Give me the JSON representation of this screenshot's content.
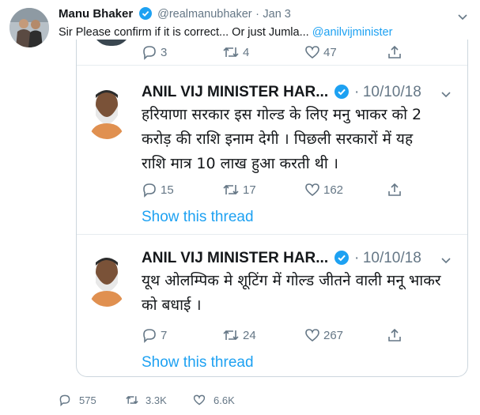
{
  "tweet": {
    "author_name": "Manu Bhaker",
    "handle": "@realmanubhaker",
    "separator": "·",
    "date": "Jan 3",
    "text": "Sir Please confirm if it is correct... Or just Jumla... ",
    "mention": "@anilvijminister"
  },
  "embed_top_stats": {
    "replies": "3",
    "retweets": "4",
    "likes": "47"
  },
  "quoted": [
    {
      "author_name": "ANIL VIJ MINISTER HAR...",
      "separator": "·",
      "date": "10/10/18",
      "lines": [
        "हरियाणा सरकार इस गोल्ड के लिए मनु भाकर को 2",
        "करोड़ की राशि इनाम देगी । पिछली सरकारों में यह",
        "राशि मात्र 10 लाख हुआ करती थी ।"
      ],
      "replies": "15",
      "retweets": "17",
      "likes": "162",
      "show_thread": "Show this thread"
    },
    {
      "author_name": "ANIL VIJ MINISTER HAR...",
      "separator": "·",
      "date": "10/10/18",
      "lines": [
        "यूथ ओलम्पिक मे शूटिंग में गोल्ड जीतने वाली मनू भाकर",
        "को बधाई ।"
      ],
      "replies": "7",
      "retweets": "24",
      "likes": "267",
      "show_thread": "Show this thread"
    }
  ],
  "tweet_stats": {
    "replies": "575",
    "retweets": "3.3K",
    "likes": "6.6K"
  },
  "colors": {
    "accent": "#1da1f2",
    "muted": "#657786",
    "border": "#ccd6dd"
  }
}
